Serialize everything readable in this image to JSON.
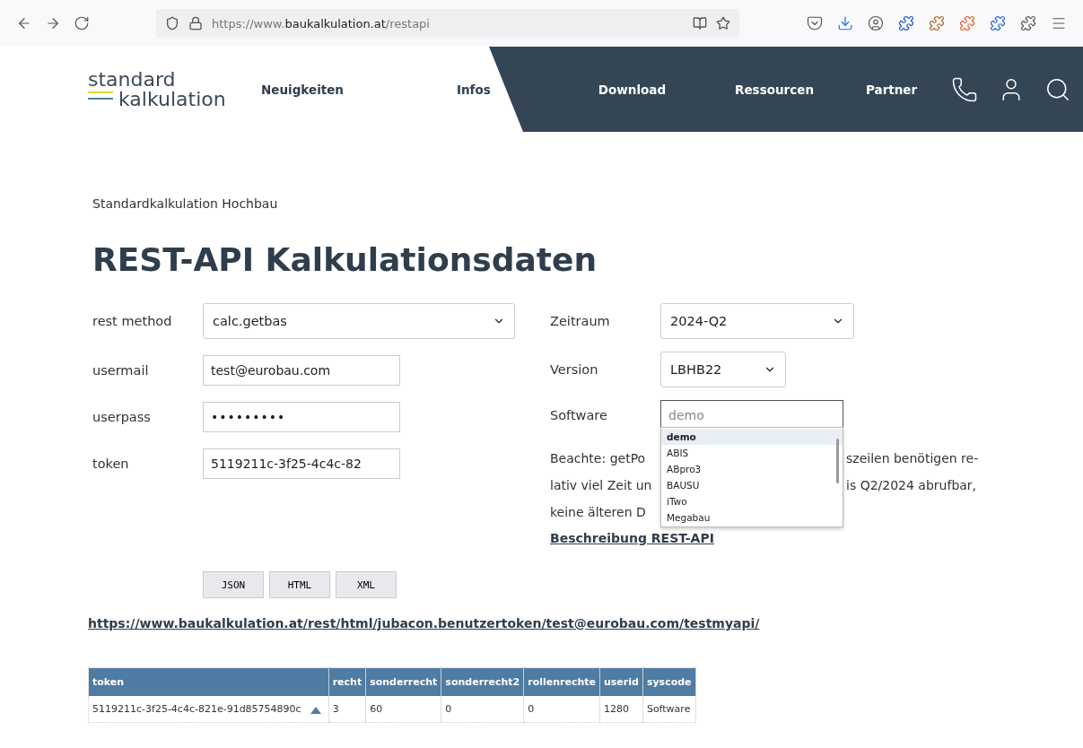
{
  "browser": {
    "url": {
      "prefix": "https://www.",
      "domain": "baukalkulation.at",
      "path": "/restapi"
    }
  },
  "header": {
    "logo": {
      "line1": "standard",
      "line2": "kalkulation"
    },
    "nav": [
      {
        "label": "Neuigkeiten",
        "dark": false
      },
      {
        "label": "Infos",
        "dark": false
      },
      {
        "label": "Download",
        "dark": true
      },
      {
        "label": "Ressourcen",
        "dark": true
      },
      {
        "label": "Partner",
        "dark": true
      }
    ]
  },
  "breadcrumb": "Standardkalkulation Hochbau",
  "title": "REST-API Kalkulationsdaten",
  "form_left": [
    {
      "label": "rest method",
      "kind": "select",
      "value": "calc.getbas"
    },
    {
      "label": "usermail",
      "kind": "text",
      "value": "test@eurobau.com"
    },
    {
      "label": "userpass",
      "kind": "password",
      "value": "•••••••••"
    },
    {
      "label": "token",
      "kind": "text",
      "value": "5119211c-3f25-4c4c-82"
    }
  ],
  "form_right": [
    {
      "label": "Zeitraum",
      "kind": "select",
      "value": "2024-Q2"
    },
    {
      "label": "Version",
      "kind": "select",
      "value": "LBHB22"
    },
    {
      "label": "Software",
      "kind": "combo",
      "placeholder": "demo"
    }
  ],
  "software_dropdown": [
    {
      "label": "demo",
      "selected": true
    },
    {
      "label": "ABIS",
      "selected": false
    },
    {
      "label": "ABpro3",
      "selected": false
    },
    {
      "label": "BAUSU",
      "selected": false
    },
    {
      "label": "iTwo",
      "selected": false
    },
    {
      "label": "Megabau",
      "selected": false
    }
  ],
  "note_lines": [
    {
      "left": "Beachte: getPo",
      "right": "szeilen benötigen re-"
    },
    {
      "left": "lativ viel Zeit un",
      "right": "is Q2/2024 abrufbar,"
    },
    {
      "left": "keine älteren D"
    }
  ],
  "description_link": "Beschreibung REST-API",
  "format_buttons": [
    "JSON",
    "HTML",
    "XML"
  ],
  "api_link": "https://www.baukalkulation.at/rest/html/jubacon.benutzertoken/test@eurobau.com/testmyapi/",
  "table": {
    "columns": [
      "token",
      "recht",
      "sonderrecht",
      "sonderrecht2",
      "rollenrechte",
      "userid",
      "syscode"
    ],
    "rows": [
      [
        "5119211c-3f25-4c4c-821e-91d85754890c",
        "3",
        "60",
        "0",
        "0",
        "1280",
        "Software"
      ]
    ]
  }
}
